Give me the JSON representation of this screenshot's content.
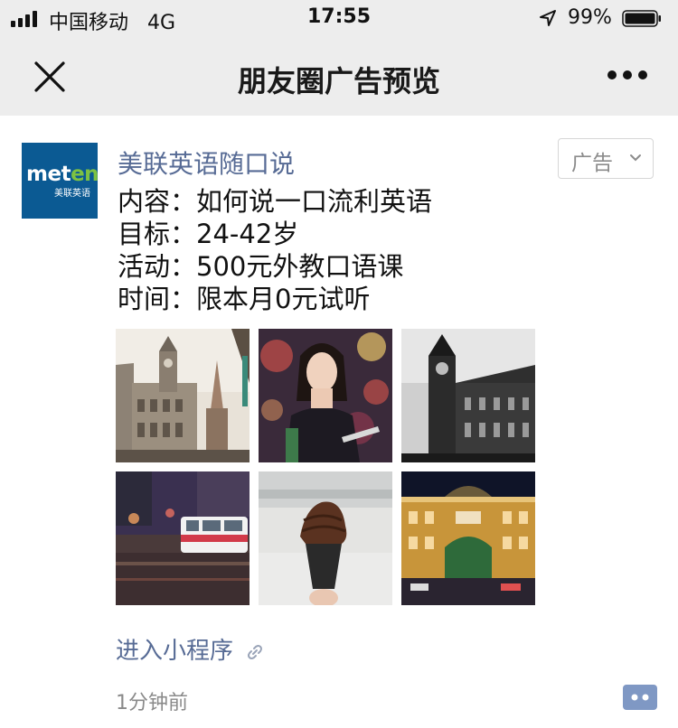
{
  "status_bar": {
    "carrier": "中国移动",
    "network": "4G",
    "time": "17:55",
    "battery": "99%"
  },
  "nav": {
    "title": "朋友圈广告预览",
    "close_icon": "close-icon",
    "more_icon": "more-icon"
  },
  "post": {
    "author": "美联英语随口说",
    "avatar_logo": "meten",
    "avatar_subtitle": "美联英语",
    "ad_label": "广告",
    "lines": [
      "内容：如何说一口流利英语",
      "目标：24-42岁",
      "活动：500元外教口语课",
      "时间：限本月0元试听"
    ],
    "images": [
      "city-hall-sepia-photo",
      "woman-portrait-bokeh-photo",
      "clock-tower-bw-photo",
      "tram-night-blur-photo",
      "chocolate-ice-cream-photo",
      "station-night-photo"
    ],
    "mini_program_link": "进入小程序",
    "timestamp": "1分钟前"
  },
  "colors": {
    "link": "#576b95",
    "nav_bg": "#ededed",
    "avatar_bg": "#0b5a93",
    "avatar_accent": "#7dc242"
  }
}
